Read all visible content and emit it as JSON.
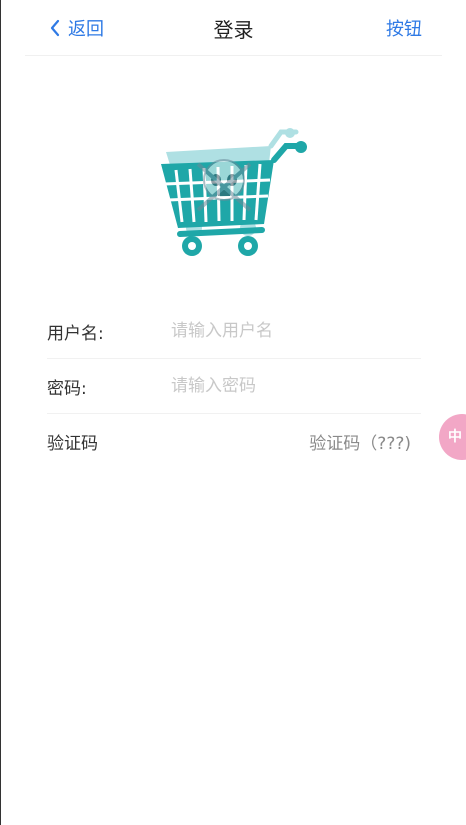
{
  "header": {
    "back_label": "返回",
    "title": "登录",
    "right_button_label": "按钮"
  },
  "form": {
    "username_label": "用户名:",
    "username_placeholder": "请输入用户名",
    "password_label": "密码:",
    "password_placeholder": "请输入密码",
    "captcha_label": "验证码",
    "captcha_button": "验证码（???)"
  },
  "float_badge": {
    "text": "中"
  },
  "colors": {
    "accent": "#2f7ae5",
    "cart_teal": "#1fa7a8",
    "cart_light": "#a7dde0",
    "badge_pink": "#f2a7c6"
  },
  "icons": {
    "back": "chevron-left-icon",
    "logo": "shopping-cart-icon"
  }
}
